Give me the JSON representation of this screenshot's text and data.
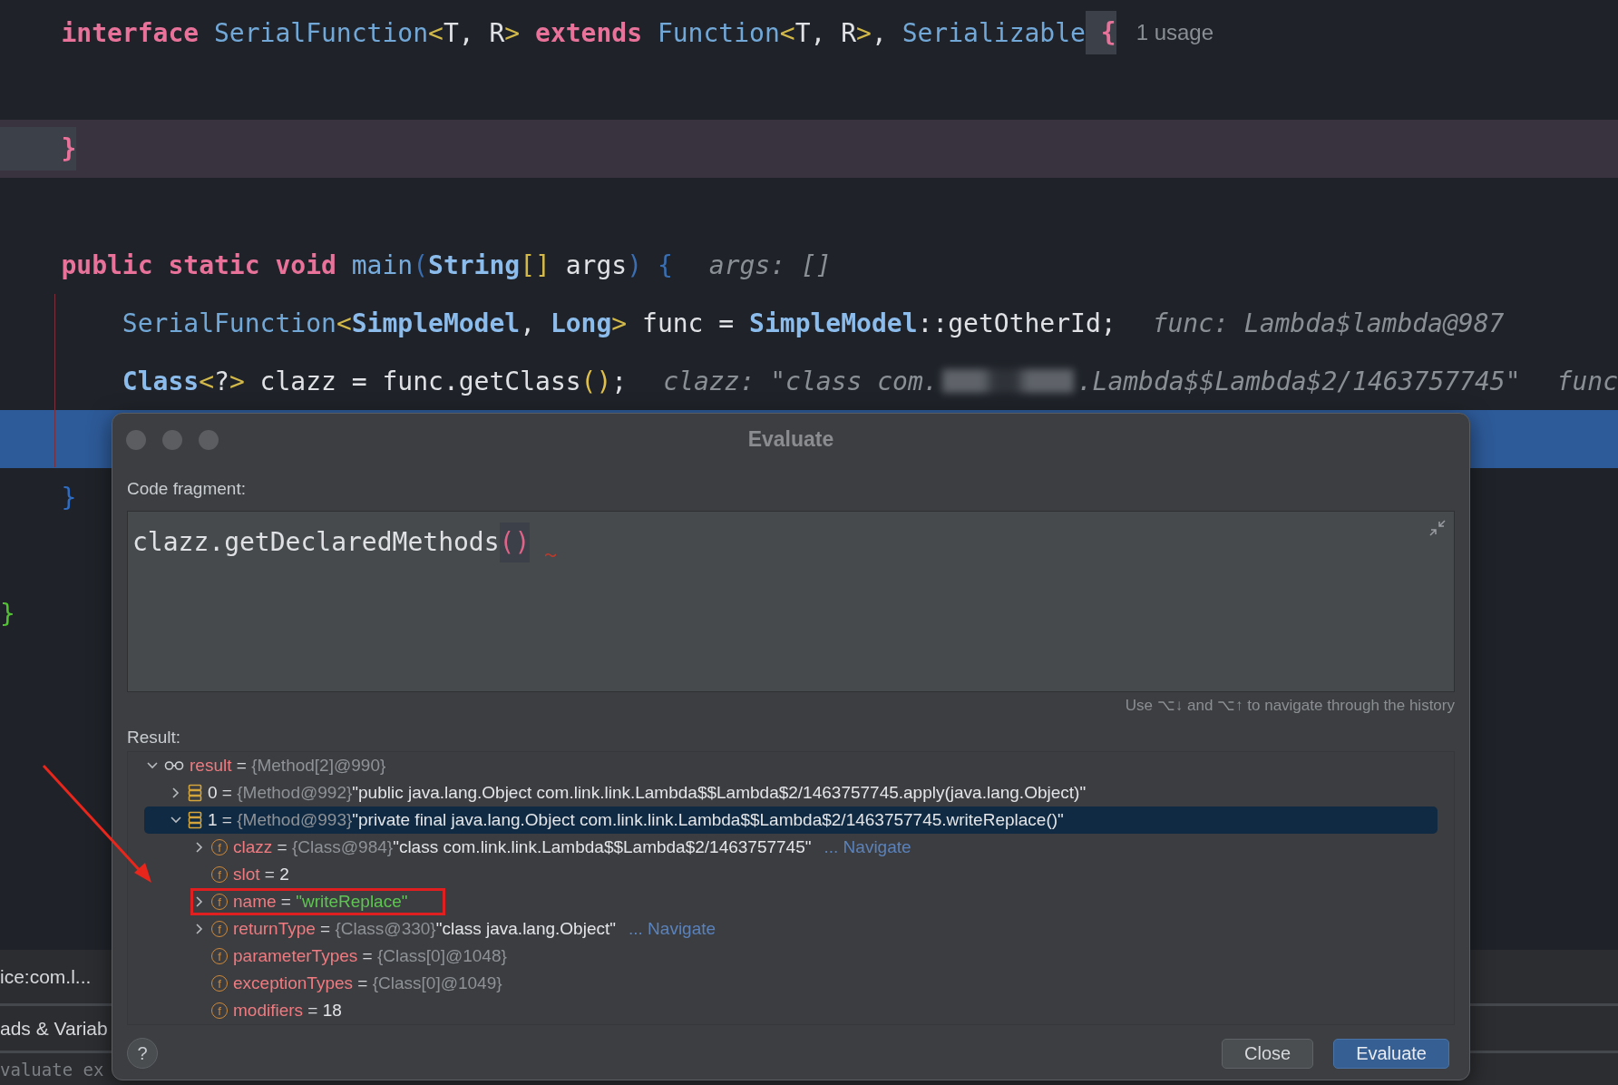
{
  "editor": {
    "lines": [
      {
        "kind": "code",
        "tokens": [
          {
            "text": "    interface",
            "kind": "keyword"
          },
          {
            "text": " SerialFunction",
            "kind": "type"
          },
          {
            "text": "<",
            "kind": "angle"
          },
          {
            "text": "T, R",
            "kind": "plain"
          },
          {
            "text": ">",
            "kind": "angle"
          },
          {
            "text": " extends",
            "kind": "keyword"
          },
          {
            "text": " Function",
            "kind": "type"
          },
          {
            "text": "<",
            "kind": "angle"
          },
          {
            "text": "T, R",
            "kind": "plain"
          },
          {
            "text": ">",
            "kind": "angle"
          },
          {
            "text": ",",
            "kind": "plain"
          },
          {
            "text": " Serializable",
            "kind": "type"
          },
          {
            "text": " {",
            "kind": "brace-key",
            "matched": true
          }
        ],
        "hints": [
          {
            "kind": "usage",
            "text": "1 usage"
          }
        ]
      },
      {
        "kind": "blank"
      },
      {
        "kind": "caret",
        "tokens": [
          {
            "text": "    }",
            "kind": "brace-key",
            "matched": true
          }
        ]
      },
      {
        "kind": "blank"
      },
      {
        "kind": "code",
        "tokens": [
          {
            "text": "    public static void",
            "kind": "keyword"
          },
          {
            "text": " main",
            "kind": "method"
          },
          {
            "text": "(",
            "kind": "paren-dim"
          },
          {
            "text": "String",
            "kind": "class"
          },
          {
            "text": "[]",
            "kind": "angle"
          },
          {
            "text": " args",
            "kind": "plain"
          },
          {
            "text": ")",
            "kind": "paren-dim"
          },
          {
            "text": " {",
            "kind": "paren-dim"
          }
        ],
        "hints": [
          {
            "kind": "value",
            "text": "args: []"
          }
        ]
      },
      {
        "kind": "code",
        "tokens": [
          {
            "text": "        SerialFunction",
            "kind": "type"
          },
          {
            "text": "<",
            "kind": "angle"
          },
          {
            "text": "SimpleModel",
            "kind": "class"
          },
          {
            "text": ",",
            "kind": "plain"
          },
          {
            "text": " Long",
            "kind": "class"
          },
          {
            "text": ">",
            "kind": "angle"
          },
          {
            "text": " func =",
            "kind": "plain"
          },
          {
            "text": " SimpleModel",
            "kind": "class"
          },
          {
            "text": "::getOtherId;",
            "kind": "plain"
          }
        ],
        "hints": [
          {
            "kind": "value",
            "text": "func: Lambda$lambda@987"
          }
        ]
      },
      {
        "kind": "code",
        "tokens": [
          {
            "text": "        Class",
            "kind": "class"
          },
          {
            "text": "<",
            "kind": "angle"
          },
          {
            "text": "?",
            "kind": "plain"
          },
          {
            "text": ">",
            "kind": "angle"
          },
          {
            "text": " clazz = func.getClass",
            "kind": "plain"
          },
          {
            "text": "()",
            "kind": "paren-yellow"
          },
          {
            "text": ";",
            "kind": "plain"
          }
        ],
        "hints": [
          {
            "kind": "value",
            "text": "clazz: \"class com."
          },
          {
            "kind": "redacted"
          },
          {
            "kind": "value",
            "text": ".Lambda$$Lambda$2/1463757745\""
          },
          {
            "kind": "value",
            "text": "func"
          }
        ]
      },
      {
        "kind": "execution"
      },
      {
        "kind": "code",
        "tokens": [
          {
            "text": "    }",
            "kind": "brace-blue"
          }
        ]
      },
      {
        "kind": "blank"
      },
      {
        "kind": "code",
        "tokens": [
          {
            "text": "}",
            "kind": "brace-green"
          }
        ]
      }
    ]
  },
  "bottom_panel": {
    "rows": [
      {
        "text": "ice:com.l..."
      },
      {
        "text": "ads & Variab"
      }
    ],
    "expression_field": {
      "placeholder": "valuate ex"
    }
  },
  "dialog": {
    "title": "Evaluate",
    "code_label": "Code fragment:",
    "code": {
      "tokens": [
        {
          "text": "clazz.getDeclaredMethods",
          "kind": "plain"
        },
        {
          "text": "()",
          "kind": "paren-pink",
          "matched": true
        }
      ],
      "error": true
    },
    "history_hint": "Use ⌥↓ and ⌥↑ to navigate through the history",
    "result_label": "Result:",
    "result_tree": [
      {
        "kind": "watch",
        "name": "result",
        "operator": "=",
        "ref": "{Method[2]@990}",
        "expanded": true,
        "selected": false,
        "children": [
          {
            "kind": "element",
            "name": "0",
            "operator": "=",
            "ref": "{Method@992}",
            "value": "\"public java.lang.Object com.link.link.Lambda$$Lambda$2/1463757745.apply(java.lang.Object)\"",
            "expanded": false,
            "selected": false
          },
          {
            "kind": "element",
            "name": "1",
            "operator": "=",
            "ref": "{Method@993}",
            "value": "\"private final java.lang.Object com.link.link.Lambda$$Lambda$2/1463757745.writeReplace()\"",
            "expanded": true,
            "selected": true,
            "children": [
              {
                "kind": "field",
                "badge": "f",
                "name": "clazz",
                "operator": "=",
                "ref": "{Class@984}",
                "value": "\"class com.link.link.Lambda$$Lambda$2/1463757745\"",
                "color": "#e3e5e8",
                "link": "... Navigate",
                "expanded": false,
                "selected": false
              },
              {
                "kind": "field",
                "badge": "f",
                "name": "slot",
                "operator": "=",
                "value": "2",
                "color": "#e3e5e8",
                "selected": false
              },
              {
                "kind": "field",
                "badge": "f",
                "name": "name",
                "operator": "=",
                "value": "\"writeReplace\"",
                "color": "#5fc552",
                "expanded": false,
                "selected": false,
                "boxed": true
              },
              {
                "kind": "field",
                "badge": "f",
                "name": "returnType",
                "operator": "=",
                "ref": "{Class@330}",
                "value": "\"class java.lang.Object\"",
                "color": "#e3e5e8",
                "link": "... Navigate",
                "expanded": false,
                "selected": false
              },
              {
                "kind": "field",
                "badge": "f",
                "name": "parameterTypes",
                "operator": "=",
                "ref": "{Class[0]@1048}",
                "selected": false
              },
              {
                "kind": "field",
                "badge": "f",
                "name": "exceptionTypes",
                "operator": "=",
                "ref": "{Class[0]@1049}",
                "selected": false
              },
              {
                "kind": "field",
                "badge": "f",
                "name": "modifiers",
                "operator": "=",
                "value": "18",
                "color": "#e3e5e8",
                "selected": false
              }
            ]
          }
        ]
      }
    ],
    "help_label": "?",
    "buttons": [
      {
        "label": "Close",
        "default": false
      },
      {
        "label": "Evaluate",
        "default": true
      }
    ]
  },
  "annotations": [
    {
      "kind": "arrow"
    }
  ]
}
